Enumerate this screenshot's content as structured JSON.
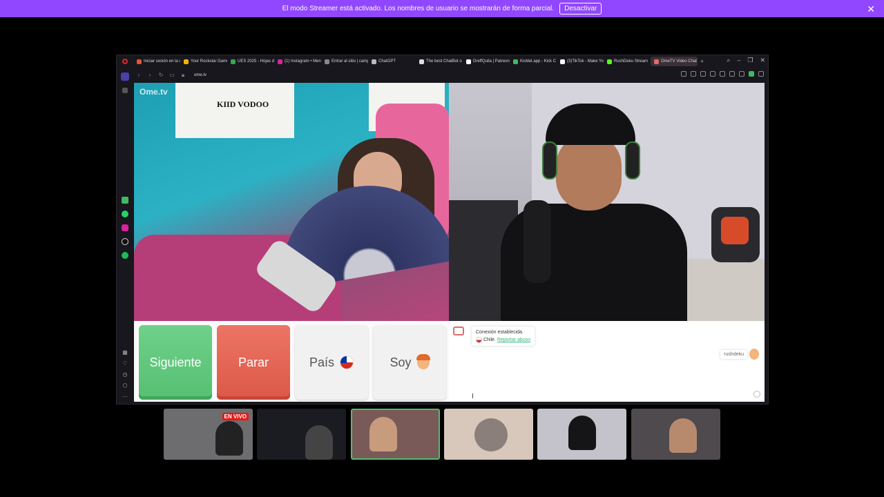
{
  "banner": {
    "message": "El modo Streamer está activado. Los nombres de usuario se mostrarán de forma parcial.",
    "button": "Desactivar",
    "close": "✕"
  },
  "tabs": [
    {
      "label": "Iniciar sesión en la c",
      "color": "#e4572e"
    },
    {
      "label": "Your Rockstar Game",
      "color": "#f5b400"
    },
    {
      "label": "UES 2025 - Hojas de",
      "color": "#34a853"
    },
    {
      "label": "(1) Instagram • Men",
      "color": "#d6249f"
    },
    {
      "label": "Entrar al sitio | camp",
      "color": "#888888"
    },
    {
      "label": "ChatGPT",
      "color": "#bbbbbb"
    },
    {
      "label": "The best ChatBot o",
      "color": "#dddddd"
    },
    {
      "label": "DreffQuila | Patreon",
      "color": "#ffffff"
    },
    {
      "label": "Kicklet.app - Kick C",
      "color": "#3fb964"
    },
    {
      "label": "(3)TikTok - Make Yo",
      "color": "#ffffff"
    },
    {
      "label": "RushDeku Stream",
      "color": "#53fc18"
    },
    {
      "label": "OmeTV Video Chat -",
      "color": "#e06b6b"
    }
  ],
  "address": {
    "url": "ome.tv"
  },
  "video": {
    "logo": "Ome.tv",
    "poster": "KIID VODOO"
  },
  "controls": {
    "next": "Siguiente",
    "stop": "Parar",
    "country": "País",
    "gender": "Soy"
  },
  "chat": {
    "status": "Conexión establecida.",
    "country": "Chile.",
    "report": "Reportar abuso",
    "my_name": "rushdeku"
  },
  "thumbs": {
    "live": "EN VIVO"
  }
}
